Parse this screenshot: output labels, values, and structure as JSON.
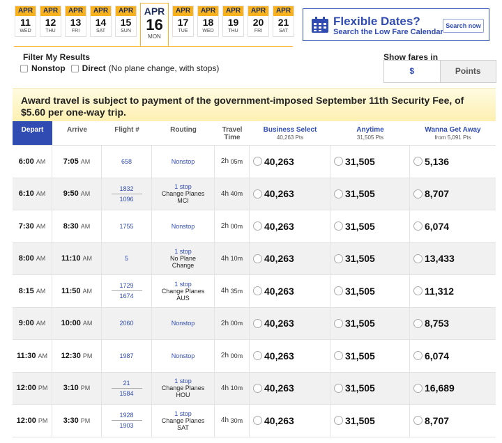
{
  "date_strip": [
    {
      "month": "APR",
      "day": "11",
      "weekday": "WED",
      "selected": false
    },
    {
      "month": "APR",
      "day": "12",
      "weekday": "THU",
      "selected": false
    },
    {
      "month": "APR",
      "day": "13",
      "weekday": "FRI",
      "selected": false
    },
    {
      "month": "APR",
      "day": "14",
      "weekday": "SAT",
      "selected": false
    },
    {
      "month": "APR",
      "day": "15",
      "weekday": "SUN",
      "selected": false
    },
    {
      "month": "APR",
      "day": "16",
      "weekday": "MON",
      "selected": true
    },
    {
      "month": "APR",
      "day": "17",
      "weekday": "TUE",
      "selected": false
    },
    {
      "month": "APR",
      "day": "18",
      "weekday": "WED",
      "selected": false
    },
    {
      "month": "APR",
      "day": "19",
      "weekday": "THU",
      "selected": false
    },
    {
      "month": "APR",
      "day": "20",
      "weekday": "FRI",
      "selected": false
    },
    {
      "month": "APR",
      "day": "21",
      "weekday": "SAT",
      "selected": false
    }
  ],
  "flexible": {
    "title": "Flexible Dates?",
    "subtitle": "Search the Low Fare Calendar",
    "button": "Search now",
    "icon": "calendar-icon"
  },
  "filters": {
    "title": "Filter My Results",
    "nonstop_label": "Nonstop",
    "direct_label": "Direct",
    "direct_note": "(No plane change, with stops)"
  },
  "fares_in": {
    "title": "Show fares in",
    "dollar_label": "$",
    "points_label": "Points"
  },
  "notice": "Award travel is subject to payment of the government-imposed September 11th Security Fee, of $5.60 per one-way trip.",
  "columns": {
    "depart": "Depart",
    "arrive": "Arrive",
    "flight": "Flight #",
    "routing": "Routing",
    "travel_time": "Travel Time",
    "business": "Business Select",
    "business_sub": "40,263 Pts",
    "anytime": "Anytime",
    "anytime_sub": "31,505 Pts",
    "wanna": "Wanna Get Away",
    "wanna_sub": "from 5,091 Pts"
  },
  "colors": {
    "brand_blue": "#304cb2",
    "accent_yellow": "#f8b21f"
  },
  "flights": [
    {
      "dep": "6:00",
      "dep_ap": "AM",
      "arr": "7:05",
      "arr_ap": "AM",
      "flights": [
        "658"
      ],
      "stops": "",
      "routing": "Nonstop",
      "duration_h": "2h",
      "duration_m": "05m",
      "business": "40,263",
      "anytime": "31,505",
      "wanna": "5,136"
    },
    {
      "dep": "6:10",
      "dep_ap": "AM",
      "arr": "9:50",
      "arr_ap": "AM",
      "flights": [
        "1832",
        "1096"
      ],
      "stops": "1 stop",
      "routing": "Change Planes",
      "routing2": "MCI",
      "duration_h": "4h",
      "duration_m": "40m",
      "business": "40,263",
      "anytime": "31,505",
      "wanna": "8,707"
    },
    {
      "dep": "7:30",
      "dep_ap": "AM",
      "arr": "8:30",
      "arr_ap": "AM",
      "flights": [
        "1755"
      ],
      "stops": "",
      "routing": "Nonstop",
      "duration_h": "2h",
      "duration_m": "00m",
      "business": "40,263",
      "anytime": "31,505",
      "wanna": "6,074"
    },
    {
      "dep": "8:00",
      "dep_ap": "AM",
      "arr": "11:10",
      "arr_ap": "AM",
      "flights": [
        "5"
      ],
      "stops": "1 stop",
      "routing": "No Plane",
      "routing2": "Change",
      "duration_h": "4h",
      "duration_m": "10m",
      "business": "40,263",
      "anytime": "31,505",
      "wanna": "13,433"
    },
    {
      "dep": "8:15",
      "dep_ap": "AM",
      "arr": "11:50",
      "arr_ap": "AM",
      "flights": [
        "1729",
        "1674"
      ],
      "stops": "1 stop",
      "routing": "Change Planes",
      "routing2": "AUS",
      "duration_h": "4h",
      "duration_m": "35m",
      "business": "40,263",
      "anytime": "31,505",
      "wanna": "11,312"
    },
    {
      "dep": "9:00",
      "dep_ap": "AM",
      "arr": "10:00",
      "arr_ap": "AM",
      "flights": [
        "2060"
      ],
      "stops": "",
      "routing": "Nonstop",
      "duration_h": "2h",
      "duration_m": "00m",
      "business": "40,263",
      "anytime": "31,505",
      "wanna": "8,753"
    },
    {
      "dep": "11:30",
      "dep_ap": "AM",
      "arr": "12:30",
      "arr_ap": "PM",
      "flights": [
        "1987"
      ],
      "stops": "",
      "routing": "Nonstop",
      "duration_h": "2h",
      "duration_m": "00m",
      "business": "40,263",
      "anytime": "31,505",
      "wanna": "6,074"
    },
    {
      "dep": "12:00",
      "dep_ap": "PM",
      "arr": "3:10",
      "arr_ap": "PM",
      "flights": [
        "21",
        "1584"
      ],
      "stops": "1 stop",
      "routing": "Change Planes",
      "routing2": "HOU",
      "duration_h": "4h",
      "duration_m": "10m",
      "business": "40,263",
      "anytime": "31,505",
      "wanna": "16,689"
    },
    {
      "dep": "12:00",
      "dep_ap": "PM",
      "arr": "3:30",
      "arr_ap": "PM",
      "flights": [
        "1928",
        "1903"
      ],
      "stops": "1 stop",
      "routing": "Change Planes",
      "routing2": "SAT",
      "duration_h": "4h",
      "duration_m": "30m",
      "business": "40,263",
      "anytime": "31,505",
      "wanna": "8,707"
    }
  ]
}
